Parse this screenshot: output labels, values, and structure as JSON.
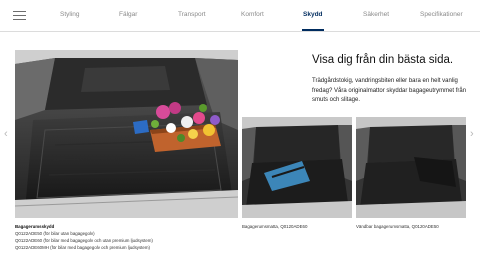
{
  "nav": {
    "menu_icon": "hamburger-icon",
    "tabs": [
      {
        "label": "Styling",
        "active": false
      },
      {
        "label": "Fälgar",
        "active": false
      },
      {
        "label": "Transport",
        "active": false
      },
      {
        "label": "Komfort",
        "active": false
      },
      {
        "label": "Skydd",
        "active": true
      },
      {
        "label": "Säkerhet",
        "active": false
      },
      {
        "label": "Specifikationer",
        "active": false
      }
    ],
    "accent_color": "#002c5f"
  },
  "carousel": {
    "prev_icon": "chevron-left-icon",
    "next_icon": "chevron-right-icon",
    "prev_glyph": "‹",
    "next_glyph": "›"
  },
  "content": {
    "headline": "Visa dig från din bästa sida.",
    "body": "Trädgårdstokig, vandringsbiten eller bara en helt vanlig fredag? Våra originalmattor skyddar bagageutrymmet från smuts och slitage."
  },
  "captions": {
    "main": {
      "title": "Bagagerumsskydd",
      "lines": [
        "Q0122ADE50 (för bilar utan bagagegolv)",
        "Q0122ADE60 (för bilar med bagagegolv och utan premium ljudsystem)",
        "Q0122ADE60MH (för bilar med bagagegolv och premium ljudsystem)"
      ]
    },
    "small_1": "Bagagerumsmatta, Q0120ADE60",
    "small_2": "Vändbar bagagerumsmatta, Q0120ADE50"
  }
}
